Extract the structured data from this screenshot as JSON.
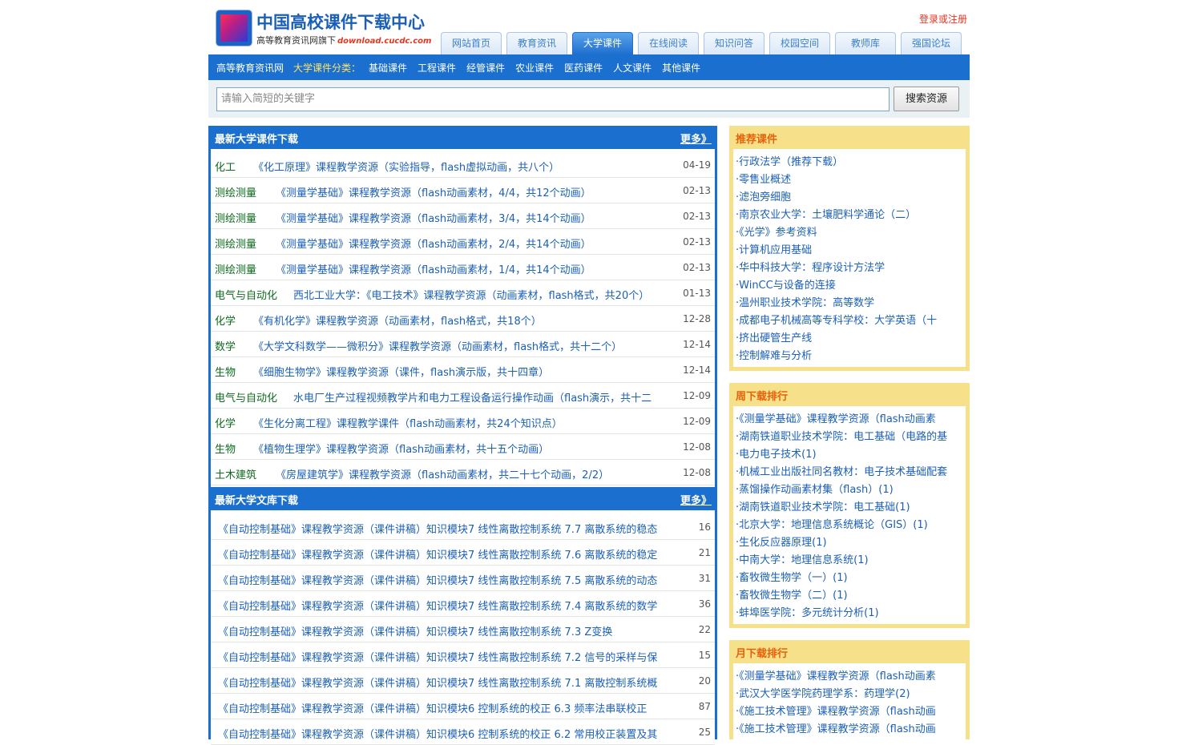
{
  "header": {
    "site_title": "中国高校课件下载中心",
    "subtitle": "高等教育资讯网旗下",
    "domain": "download.cucdc.com",
    "login": "登录或注册",
    "nav": [
      {
        "label": "网站首页",
        "active": false
      },
      {
        "label": "教育资讯",
        "active": false
      },
      {
        "label": "大学课件",
        "active": true
      },
      {
        "label": "在线阅读",
        "active": false
      },
      {
        "label": "知识问答",
        "active": false
      },
      {
        "label": "校园空间",
        "active": false
      },
      {
        "label": "教师库",
        "active": false
      },
      {
        "label": "强国论坛",
        "active": false
      }
    ]
  },
  "catbar": {
    "home": "高等教育资讯网",
    "label": "大学课件分类：",
    "categories": [
      "基础课件",
      "工程课件",
      "经管课件",
      "农业课件",
      "医药课件",
      "人文课件",
      "其他课件"
    ]
  },
  "search": {
    "placeholder": "请输入简短的关键字",
    "button": "搜索资源"
  },
  "latest_courseware": {
    "title": "最新大学课件下载",
    "more": "更多》",
    "rows": [
      {
        "cat": "化工",
        "title": "《化工原理》课程教学资源（实验指导，flash虚拟动画，共八个）",
        "date": "04-19"
      },
      {
        "cat": "测绘测量",
        "title": "《测量学基础》课程教学资源（flash动画素材，4/4，共12个动画）",
        "date": "02-13"
      },
      {
        "cat": "测绘测量",
        "title": "《测量学基础》课程教学资源（flash动画素材，3/4，共14个动画）",
        "date": "02-13"
      },
      {
        "cat": "测绘测量",
        "title": "《测量学基础》课程教学资源（flash动画素材，2/4，共14个动画）",
        "date": "02-13"
      },
      {
        "cat": "测绘测量",
        "title": "《测量学基础》课程教学资源（flash动画素材，1/4，共14个动画）",
        "date": "02-13"
      },
      {
        "cat": "电气与自动化",
        "title": "西北工业大学：《电工技术》课程教学资源（动画素材，flash格式，共20个）",
        "date": "01-13"
      },
      {
        "cat": "化学",
        "title": "《有机化学》课程教学资源（动画素材，flash格式，共18个）",
        "date": "12-28"
      },
      {
        "cat": "数学",
        "title": "《大学文科数学——微积分》课程教学资源（动画素材，flash格式，共十二个）",
        "date": "12-14"
      },
      {
        "cat": "生物",
        "title": "《细胞生物学》课程教学资源（课件，flash演示版，共十四章）",
        "date": "12-14"
      },
      {
        "cat": "电气与自动化",
        "title": "水电厂生产过程视频教学片和电力工程设备运行操作动画（flash演示，共十二",
        "date": "12-09"
      },
      {
        "cat": "化学",
        "title": "《生化分离工程》课程教学课件（flash动画素材，共24个知识点）",
        "date": "12-09"
      },
      {
        "cat": "生物",
        "title": "《植物生理学》课程教学资源（flash动画素材，共十五个动画）",
        "date": "12-08"
      },
      {
        "cat": "土木建筑",
        "title": "《房屋建筑学》课程教学资源（flash动画素材，共二十七个动画，2/2）",
        "date": "12-08"
      }
    ]
  },
  "latest_library": {
    "title": "最新大学文库下载",
    "more": "更多》",
    "rows": [
      {
        "title": "《自动控制基础》课程教学资源（课件讲稿）知识模块7 线性离散控制系统 7.7 离散系统的稳态",
        "count": "16"
      },
      {
        "title": "《自动控制基础》课程教学资源（课件讲稿）知识模块7 线性离散控制系统 7.6 离散系统的稳定",
        "count": "21"
      },
      {
        "title": "《自动控制基础》课程教学资源（课件讲稿）知识模块7 线性离散控制系统 7.5 离散系统的动态",
        "count": "31"
      },
      {
        "title": "《自动控制基础》课程教学资源（课件讲稿）知识模块7 线性离散控制系统 7.4 离散系统的数学",
        "count": "36"
      },
      {
        "title": "《自动控制基础》课程教学资源（课件讲稿）知识模块7 线性离散控制系统 7.3 Z变换",
        "count": "22"
      },
      {
        "title": "《自动控制基础》课程教学资源（课件讲稿）知识模块7 线性离散控制系统 7.2 信号的采样与保",
        "count": "15"
      },
      {
        "title": "《自动控制基础》课程教学资源（课件讲稿）知识模块7 线性离散控制系统 7.1 离散控制系统概",
        "count": "20"
      },
      {
        "title": "《自动控制基础》课程教学资源（课件讲稿）知识模块6 控制系统的校正 6.3 频率法串联校正",
        "count": "87"
      },
      {
        "title": "《自动控制基础》课程教学资源（课件讲稿）知识模块6 控制系统的校正 6.2 常用校正装置及其",
        "count": "25"
      }
    ]
  },
  "recommended": {
    "title": "推荐课件",
    "items": [
      "·行政法学（推荐下载）",
      "·零售业概述",
      "·滤泡旁细胞",
      "·南京农业大学：土壤肥料学通论（二）",
      "·《光学》参考资料",
      "·计算机应用基础",
      "·华中科技大学：程序设计方法学",
      "·WinCC与设备的连接",
      "·温州职业技术学院：高等数学",
      "·成都电子机械高等专科学校：大学英语（十",
      "·挤出硬管生产线",
      "·控制解难与分析"
    ]
  },
  "weekly": {
    "title": "周下载排行",
    "items": [
      "·《测量学基础》课程教学资源（flash动画素",
      "·湖南铁道职业技术学院：电工基础（电路的基",
      "·电力电子技术(1)",
      "·机械工业出版社同名教材：电子技术基础配套",
      "·蒸馏操作动画素材集（flash）(1)",
      "·湖南铁道职业技术学院：电工基础(1)",
      "·北京大学：地理信息系统概论（GIS）(1)",
      "·生化反应器原理(1)",
      "·中南大学：地理信息系统(1)",
      "·畜牧微生物学（一）(1)",
      "·畜牧微生物学（二）(1)",
      "·蚌埠医学院：多元统计分析(1)"
    ]
  },
  "monthly": {
    "title": "月下载排行",
    "items": [
      "·《测量学基础》课程教学资源（flash动画素",
      "·武汉大学医学院药理学系：药理学(2)",
      "·《施工技术管理》课程教学资源（flash动画",
      "·《施工技术管理》课程教学资源（flash动画"
    ]
  },
  "colors": {
    "primary_blue": "#1b70cf",
    "link_blue": "#1b5fb8",
    "category_green": "#0f6a1f",
    "sidebar_yellow": "#f7e08a",
    "sidebar_title": "#e5620b",
    "login_red": "#e8341f"
  }
}
